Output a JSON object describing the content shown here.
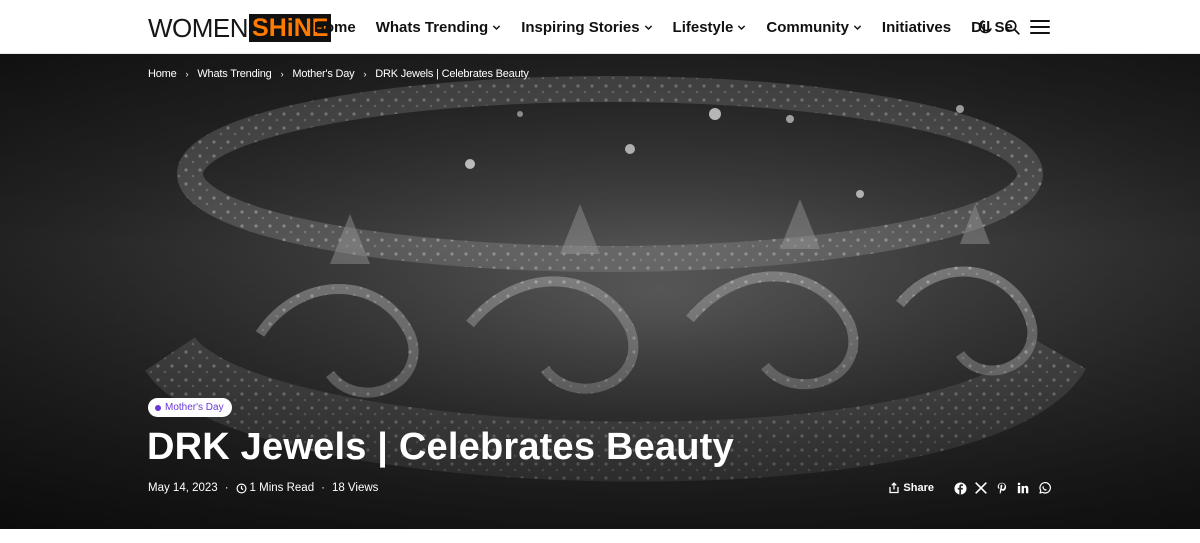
{
  "header": {
    "logo": {
      "part1": "WOMEN",
      "part2": "SHiNE"
    },
    "nav": [
      {
        "label": "Home",
        "dropdown": false
      },
      {
        "label": "Whats Trending",
        "dropdown": true
      },
      {
        "label": "Inspiring Stories",
        "dropdown": true
      },
      {
        "label": "Lifestyle",
        "dropdown": true
      },
      {
        "label": "Community",
        "dropdown": true
      },
      {
        "label": "Initiatives",
        "dropdown": false
      },
      {
        "label": "Dil Se",
        "dropdown": false
      }
    ],
    "tools": [
      "dark-mode-icon",
      "search-icon",
      "menu-icon"
    ]
  },
  "breadcrumb": [
    "Home",
    "Whats Trending",
    "Mother's Day",
    "DRK Jewels | Celebrates Beauty"
  ],
  "article": {
    "category": "Mother's Day",
    "title": "DRK Jewels | Celebrates Beauty",
    "date": "May 14, 2023",
    "read_time": "1 Mins Read",
    "views": "18 Views"
  },
  "share": {
    "label": "Share",
    "icons": [
      "facebook-icon",
      "x-icon",
      "pinterest-icon",
      "linkedin-icon",
      "whatsapp-icon"
    ]
  },
  "colors": {
    "accent": "#6a38d6",
    "logo_orange": "#ff7a00",
    "logo_dark": "#111111"
  }
}
